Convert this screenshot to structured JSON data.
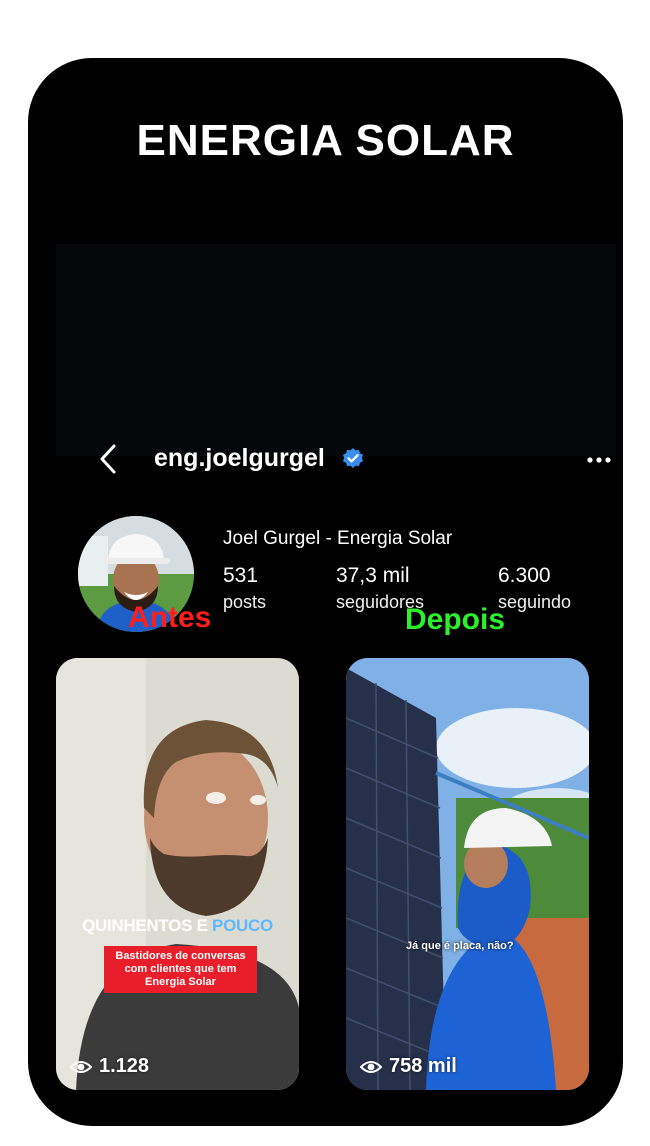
{
  "header": {
    "title": "ENERGIA SOLAR"
  },
  "profile": {
    "username": "eng.joelgurgel",
    "display_name": "Joel Gurgel - Energia Solar",
    "stats": [
      {
        "value": "531",
        "label": "posts"
      },
      {
        "value": "37,3 mil",
        "label": "seguidores"
      },
      {
        "value": "6.300",
        "label": "seguindo"
      }
    ]
  },
  "comparison": {
    "before_label": "Antes",
    "after_label": "Depois",
    "before_video": {
      "overlay_title": "QUINHENTOS E",
      "overlay_title_highlight": "POUCO",
      "overlay_subtitle": "Bastidores de conversas com clientes que tem Energia Solar",
      "views": "1.128"
    },
    "after_video": {
      "caption": "Já que é placa, não?",
      "views": "758 mil"
    }
  },
  "colors": {
    "before": "#ff1e1e",
    "after": "#2cf02c",
    "verified": "#3a8ef0",
    "highlight": "#5fb8ff"
  },
  "icons": [
    "back-icon",
    "verified-icon",
    "more-icon",
    "eye-icon"
  ]
}
